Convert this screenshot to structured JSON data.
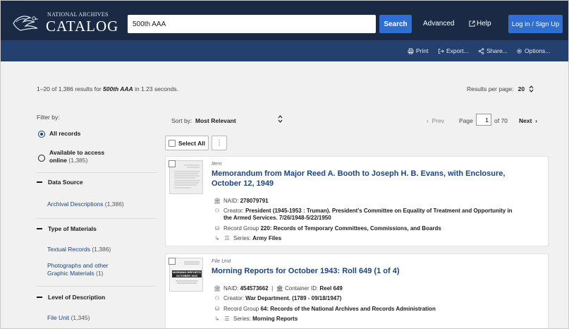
{
  "header": {
    "logo_small": "NATIONAL ARCHIVES",
    "logo_big": "CATALOG",
    "search_value": "500th AAA",
    "search_button": "Search",
    "advanced_label": "Advanced",
    "help_label": "Help",
    "login_label": "Log in / Sign Up"
  },
  "toolbar": {
    "print": "Print",
    "export": "Export...",
    "share": "Share...",
    "options": "Options..."
  },
  "summary": {
    "prefix": "1–20 of 1,386 results for ",
    "query": "500th AAA",
    "suffix": " in 1.23 seconds.",
    "per_page_label": "Results per page:",
    "per_page_value": "20"
  },
  "sidebar": {
    "filter_by": "Filter by:",
    "all_records": "All records",
    "available_line1": "Available to access",
    "available_line2": "online",
    "available_count": "(1,385)",
    "facets": [
      {
        "heading": "Data Source",
        "items": [
          {
            "label": "Archival Descriptions",
            "count": "(1,386)"
          }
        ]
      },
      {
        "heading": "Type of Materials",
        "items": [
          {
            "label": "Textual Records",
            "count": "(1,386)"
          },
          {
            "label_line1": "Photographs and other",
            "label_line2": "Graphic Materials",
            "count": "(1)"
          }
        ]
      },
      {
        "heading": "Level of Description",
        "items": [
          {
            "label": "File Unit",
            "count": "(1,345)"
          }
        ]
      }
    ]
  },
  "sort": {
    "label": "Sort by:",
    "value": "Most Relevant"
  },
  "pager": {
    "prev": "Prev",
    "page_label": "Page",
    "page_value": "1",
    "of": "of 70",
    "next": "Next"
  },
  "selection": {
    "select_all": "Select All"
  },
  "results": [
    {
      "type": "Item",
      "title_line1": "Memorandum from Major Reed A. Booth to Joseph H. B. Evans, with Enclosure,",
      "title_line2": "October 12, 1949",
      "naid_label": "NAID:",
      "naid": "278079791",
      "creator_label": "Creator:",
      "creator_line1": "President (1945-1953 : Truman). President's Committee on Equality of Treatment and Opportunity in",
      "creator_line2": "the Armed Services. 7/26/1948-5/22/1950",
      "record_group_label": "Record Group",
      "record_group": "220: Records of Temporary Committees, Commissions, and Boards",
      "series_label": "Series:",
      "series": "Army Files"
    },
    {
      "type": "File Unit",
      "title_line1": "Morning Reports for October 1943: Roll 649 (1 of 4)",
      "naid_label": "NAID:",
      "naid": "454573662",
      "container_label": "Container ID:",
      "container": "Reel 649",
      "creator_label": "Creator:",
      "creator_line1": "War Department. (1789 - 09/18/1947)",
      "record_group_label": "Record Group",
      "record_group": "64: Records of the National Archives and Records Administration",
      "series_label": "Series:",
      "series": "Morning Reports",
      "thumb_text": "MORNING REPORTS OCTOBER 1943"
    }
  ],
  "colors": {
    "header": "#1a2a44",
    "toolbar": "#24406e",
    "accent": "#2e6fd3",
    "link": "#1a4480",
    "page_bg": "#f1f1f1"
  }
}
